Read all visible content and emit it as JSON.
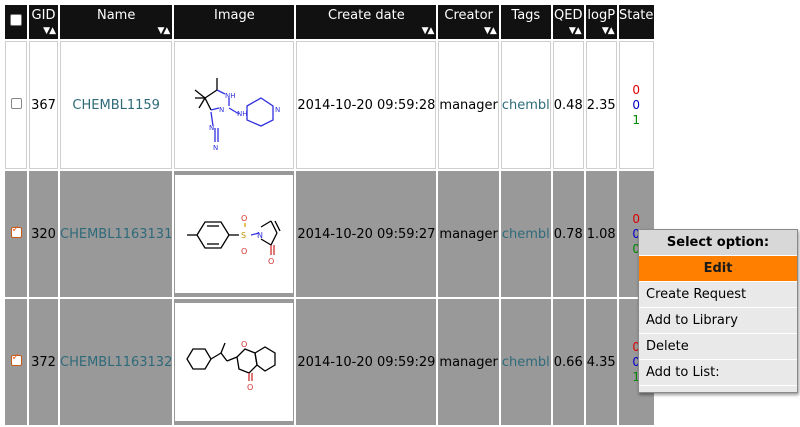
{
  "columns": [
    {
      "key": "select",
      "label": ""
    },
    {
      "key": "gid",
      "label": "GID",
      "sortable": true
    },
    {
      "key": "name",
      "label": "Name",
      "sortable": true
    },
    {
      "key": "image",
      "label": "Image",
      "sortable": false
    },
    {
      "key": "create_date",
      "label": "Create date",
      "sortable": true
    },
    {
      "key": "creator",
      "label": "Creator",
      "sortable": true
    },
    {
      "key": "tags",
      "label": "Tags",
      "sortable": false
    },
    {
      "key": "qed",
      "label": "QED",
      "sortable": true
    },
    {
      "key": "logp",
      "label": "logP",
      "sortable": true
    },
    {
      "key": "state",
      "label": "State",
      "sortable": false
    }
  ],
  "sort_icon": "▼▲",
  "rows": [
    {
      "selected": false,
      "gid": "367",
      "name": "CHEMBL1159",
      "image": "molecule-structure",
      "create_date": "2014-10-20 09:59:28",
      "creator": "manager",
      "tags": "chembl",
      "qed": "0.48",
      "logp": "2.35",
      "state": [
        "0",
        "0",
        "1"
      ]
    },
    {
      "selected": true,
      "gid": "320",
      "name": "CHEMBL1163131",
      "image": "molecule-structure",
      "create_date": "2014-10-20 09:59:27",
      "creator": "manager",
      "tags": "chembl",
      "qed": "0.78",
      "logp": "1.08",
      "state": [
        "0",
        "0",
        "0"
      ]
    },
    {
      "selected": true,
      "gid": "372",
      "name": "CHEMBL1163132",
      "image": "molecule-structure",
      "create_date": "2014-10-20 09:59:29",
      "creator": "manager",
      "tags": "chembl",
      "qed": "0.66",
      "logp": "4.35",
      "state": [
        "0",
        "0",
        "1"
      ]
    }
  ],
  "molecule_atoms": {
    "m1": [
      "NH",
      "NH",
      "N",
      "N",
      "N",
      "N"
    ],
    "m2": [
      "S",
      "O",
      "O",
      "N",
      "O"
    ],
    "m3": [
      "O",
      "O"
    ]
  },
  "state_colors": [
    "#dd0000",
    "#0000cc",
    "#008800"
  ],
  "context_menu": {
    "title": "Select option:",
    "items": [
      "Edit",
      "Create Request",
      "Add to Library",
      "Delete",
      "Add to List:"
    ],
    "highlighted": "Edit"
  },
  "colors": {
    "header_bg": "#111111",
    "selected_row_bg": "#999999",
    "link": "#2e6a7a",
    "menu_highlight": "#ff8000"
  }
}
